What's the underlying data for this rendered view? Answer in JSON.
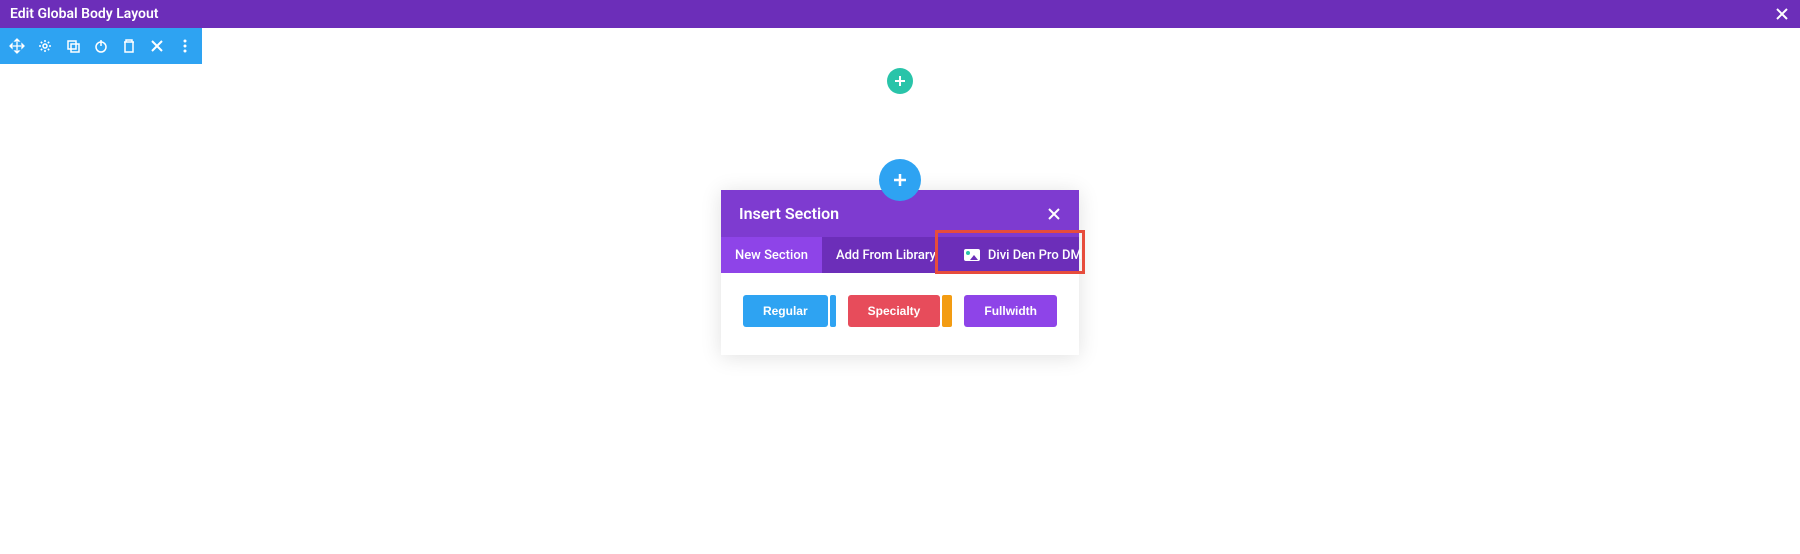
{
  "topBar": {
    "title": "Edit Global Body Layout"
  },
  "modal": {
    "title": "Insert Section",
    "tabs": [
      {
        "label": "New Section",
        "active": true
      },
      {
        "label": "Add From Library",
        "active": false
      },
      {
        "label": "Divi Den Pro DM",
        "active": false
      }
    ],
    "types": {
      "regular": "Regular",
      "specialty": "Specialty",
      "fullwidth": "Fullwidth"
    }
  }
}
